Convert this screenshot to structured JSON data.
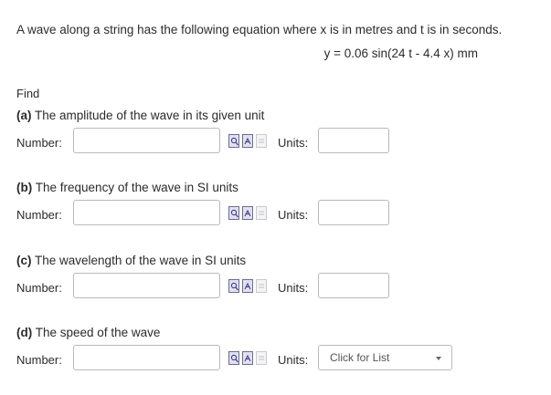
{
  "problem": {
    "intro": "A wave along a string has the following equation where x is in metres and t is in seconds.",
    "equation": "y = 0.06 sin(24 t - 4.4 x) mm",
    "find_label": "Find"
  },
  "parts": [
    {
      "letter": "(a)",
      "text": "The amplitude of the wave in its given unit",
      "number_label": "Number:",
      "number_value": "",
      "units_label": "Units:",
      "units_value": ""
    },
    {
      "letter": "(b)",
      "text": "The frequency of the wave in SI units",
      "number_label": "Number:",
      "number_value": "",
      "units_label": "Units:",
      "units_value": ""
    },
    {
      "letter": "(c)",
      "text": "The wavelength of the wave in SI units",
      "number_label": "Number:",
      "number_value": "",
      "units_label": "Units:",
      "units_value": ""
    },
    {
      "letter": "(d)",
      "text": "The speed of the wave",
      "number_label": "Number:",
      "number_value": "",
      "units_label": "Units:",
      "units_select_value": "Click for List"
    }
  ],
  "icons": [
    "hint-icon",
    "solution-icon",
    "document-icon"
  ]
}
